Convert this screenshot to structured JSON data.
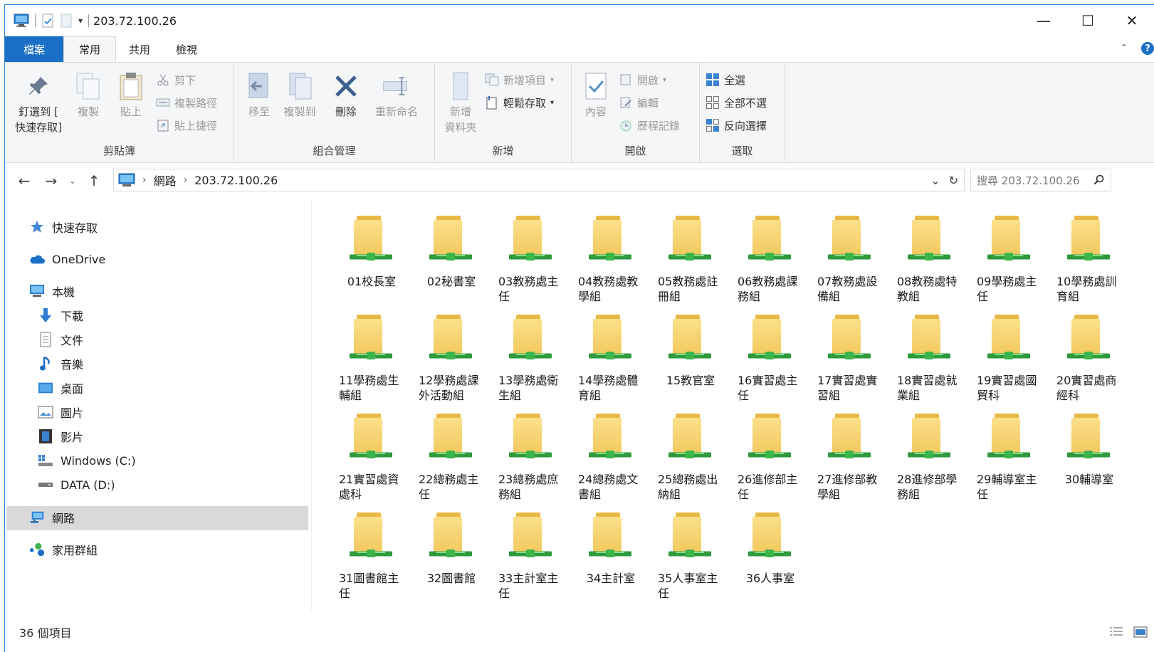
{
  "window": {
    "title": "203.72.100.26"
  },
  "controls": {
    "minimize": "—",
    "maximize": "☐",
    "close": "✕",
    "collapse": "⌃",
    "help": "?"
  },
  "tabs": [
    {
      "label": "檔案"
    },
    {
      "label": "常用"
    },
    {
      "label": "共用"
    },
    {
      "label": "檢視"
    }
  ],
  "ribbon": {
    "clipboard": {
      "group": "剪貼簿",
      "pin": "釘選到 [\n快速存取]",
      "copy": "複製",
      "paste": "貼上",
      "cut": "剪下",
      "copy_path": "複製路徑",
      "paste_shortcut": "貼上捷徑"
    },
    "organize": {
      "group": "組合管理",
      "move_to": "移至",
      "copy_to": "複製到",
      "delete": "刪除",
      "rename": "重新命名"
    },
    "new": {
      "group": "新增",
      "new_folder": "新增\n資料夾",
      "new_item": "新增項目",
      "easy_access": "輕鬆存取"
    },
    "open": {
      "group": "開啟",
      "properties": "內容",
      "open": "開啟",
      "edit": "編輯",
      "history": "歷程記錄"
    },
    "select": {
      "group": "選取",
      "select_all": "全選",
      "select_none": "全部不選",
      "invert": "反向選擇"
    }
  },
  "address": {
    "root": "網路",
    "current": "203.72.100.26",
    "search_placeholder": "搜尋 203.72.100.26"
  },
  "nav": {
    "quick_access": "快速存取",
    "onedrive": "OneDrive",
    "this_pc": "本機",
    "downloads": "下載",
    "documents": "文件",
    "music": "音樂",
    "desktop": "桌面",
    "pictures": "圖片",
    "videos": "影片",
    "drive_c": "Windows (C:)",
    "drive_d": "DATA (D:)",
    "network": "網路",
    "homegroup": "家用群組"
  },
  "folders": [
    "01校長室",
    "02秘書室",
    "03教務處主任",
    "04教務處教學組",
    "05教務處註冊組",
    "06教務處課務組",
    "07教務處設備組",
    "08教務處特教組",
    "09學務處主任",
    "10學務處訓育組",
    "11學務處生輔組",
    "12學務處課外活動組",
    "13學務處衛生組",
    "14學務處體育組",
    "15教官室",
    "16實習處主任",
    "17實習處實習組",
    "18實習處就業組",
    "19實習處國貿科",
    "20實習處商經科",
    "21實習處資處科",
    "22總務處主任",
    "23總務處庶務組",
    "24總務處文書組",
    "25總務處出納組",
    "26進修部主任",
    "27進修部教學組",
    "28進修部學務組",
    "29輔導室主任",
    "30輔導室",
    "31圖書館主任",
    "32圖書館",
    "33主計室主任",
    "34主計室",
    "35人事室主任",
    "36人事室"
  ],
  "status": {
    "count": "36 個項目"
  }
}
